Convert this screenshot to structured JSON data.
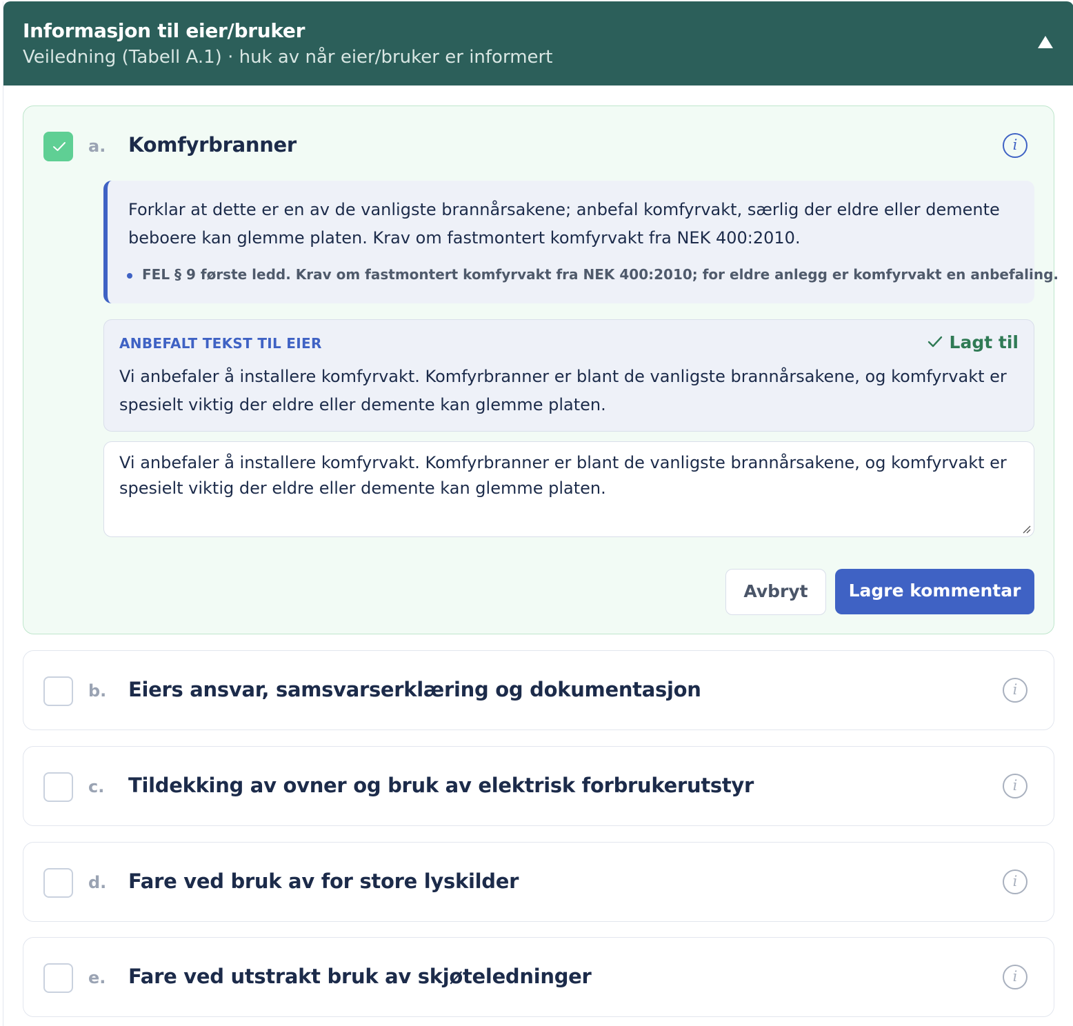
{
  "header": {
    "title": "Informasjon til eier/bruker",
    "subtitle": "Veiledning (Tabell A.1) · huk av når eier/bruker er informert",
    "collapse_icon": "triangle-up-icon"
  },
  "items": [
    {
      "letter": "a.",
      "title": "Komfyrbranner",
      "checked": true,
      "expanded": true,
      "guidance": "Forklar at dette er en av de vanligste brannårsakene; anbefal komfyrvakt, særlig der eldre eller demente beboere kan glemme platen. Krav om fastmontert komfyrvakt fra NEK 400:2010.",
      "reference": "FEL § 9 første ledd. Krav om fastmontert komfyrvakt fra NEK 400:2010; for eldre anlegg er komfyrvakt en anbefaling.",
      "recommended_label": "ANBEFALT TEKST TIL EIER",
      "recommended_status": "Lagt til",
      "recommended_text": "Vi anbefaler å installere komfyrvakt. Komfyrbranner er blant de vanligste brannårsakene, og komfyrvakt er spesielt viktig der eldre eller demente kan glemme platen.",
      "comment_value": "Vi anbefaler å installere komfyrvakt. Komfyrbranner er blant de vanligste brannårsakene, og komfyrvakt er spesielt viktig der eldre eller demente kan glemme platen.",
      "cancel_label": "Avbryt",
      "save_label": "Lagre kommentar"
    },
    {
      "letter": "b.",
      "title": "Eiers ansvar, samsvarserklæring og dokumentasjon",
      "checked": false
    },
    {
      "letter": "c.",
      "title": "Tildekking av ovner og bruk av elektrisk forbrukerutstyr",
      "checked": false
    },
    {
      "letter": "d.",
      "title": "Fare ved bruk av for store lyskilder",
      "checked": false
    },
    {
      "letter": "e.",
      "title": "Fare ved utstrakt bruk av skjøteledninger",
      "checked": false
    }
  ],
  "icons": {
    "info": "info-icon",
    "check": "check-icon"
  },
  "colors": {
    "header_bg": "#2c5f5a",
    "accent_blue": "#3f62c4",
    "checked_green": "#5fcf94",
    "added_green": "#2f7a55",
    "active_card_bg": "#f2fbf5"
  }
}
